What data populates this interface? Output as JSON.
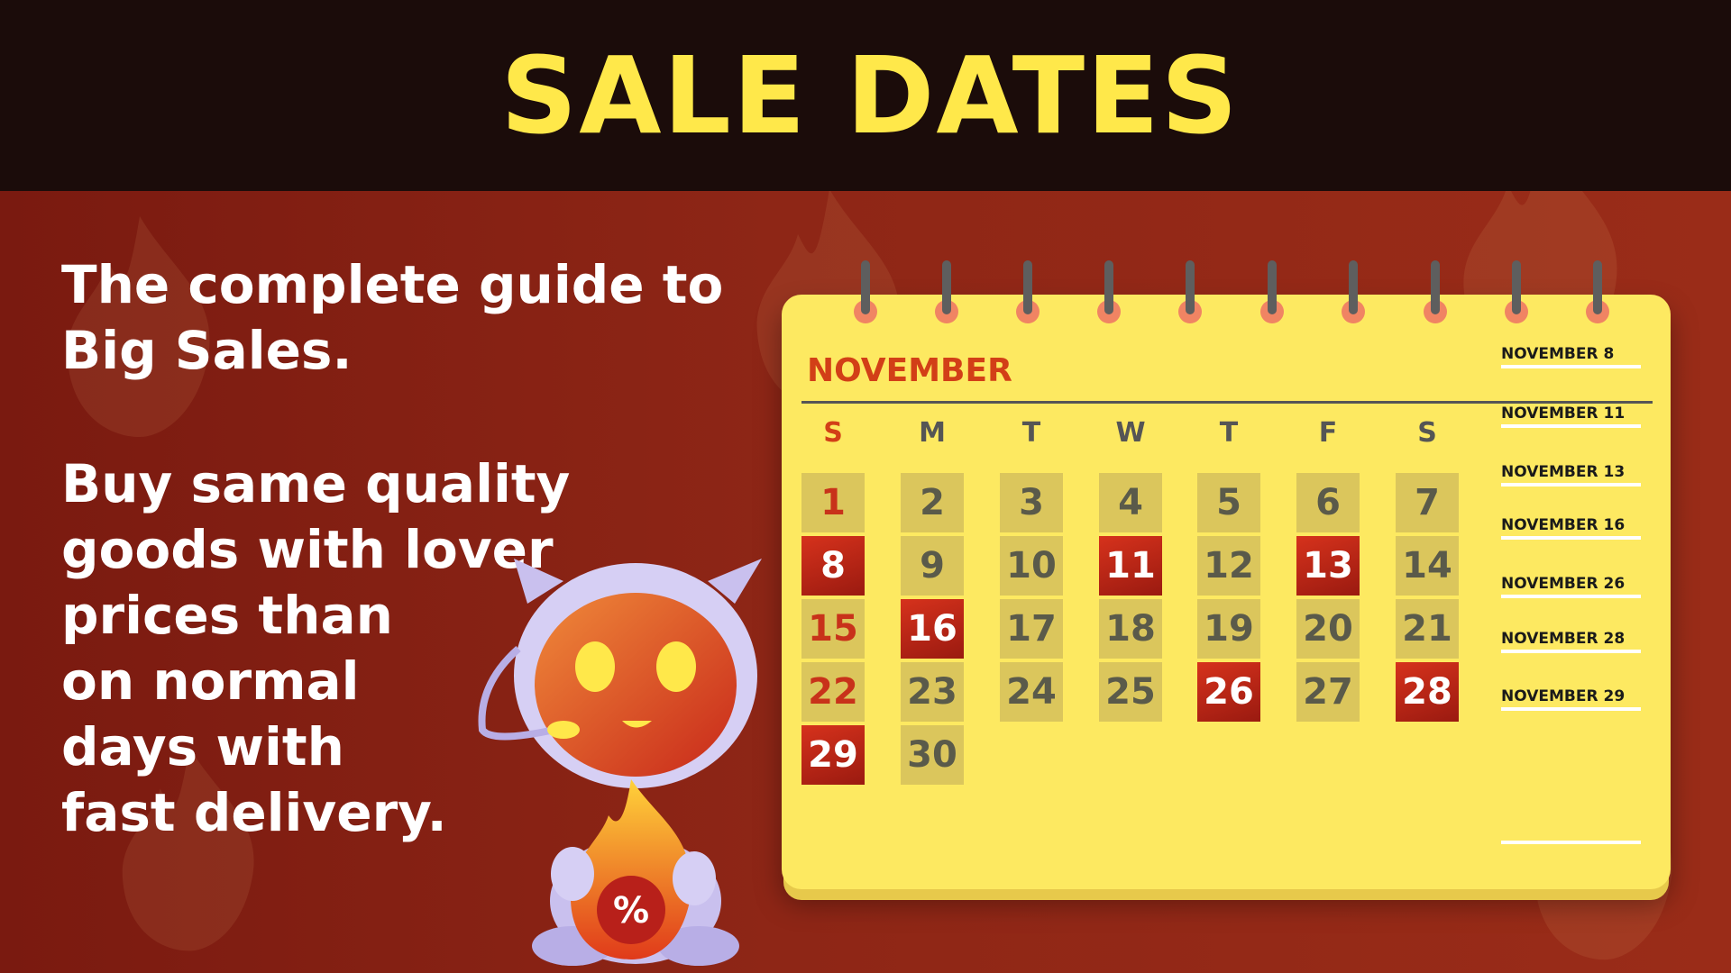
{
  "header": {
    "title": "SALE DATES"
  },
  "intro": {
    "paragraph1": [
      "The complete guide to",
      "Big Sales."
    ],
    "paragraph2": [
      "Buy same quality",
      "goods with lover",
      "prices than",
      "on normal",
      "days with",
      "fast delivery."
    ]
  },
  "calendar": {
    "month": "NOVEMBER",
    "weekdays": [
      "S",
      "M",
      "T",
      "W",
      "T",
      "F",
      "S"
    ],
    "weeks": [
      [
        "1",
        "2",
        "3",
        "4",
        "5",
        "6",
        "7"
      ],
      [
        "8",
        "9",
        "10",
        "11",
        "12",
        "13",
        "14"
      ],
      [
        "15",
        "16",
        "17",
        "18",
        "19",
        "20",
        "21"
      ],
      [
        "22",
        "23",
        "24",
        "25",
        "26",
        "27",
        "28"
      ],
      [
        "29",
        "30"
      ]
    ],
    "sale_days": [
      "8",
      "11",
      "13",
      "16",
      "26",
      "28",
      "29"
    ],
    "sale_list": [
      "NOVEMBER 8",
      "NOVEMBER 11",
      "NOVEMBER 13",
      "NOVEMBER 16",
      "NOVEMBER 26",
      "NOVEMBER 28",
      "NOVEMBER 29"
    ]
  },
  "mascot": {
    "badge_text": "%"
  },
  "colors": {
    "title": "#ffe84a",
    "calendar_bg": "#fde961",
    "sale_day": "#c8281a",
    "sunday_text": "#d23f17",
    "background": "#8a2417",
    "header_bg": "#1b0c0a"
  },
  "icons": [
    "flame-percent-icon",
    "robot-mascot",
    "spiral-ring-icon"
  ]
}
